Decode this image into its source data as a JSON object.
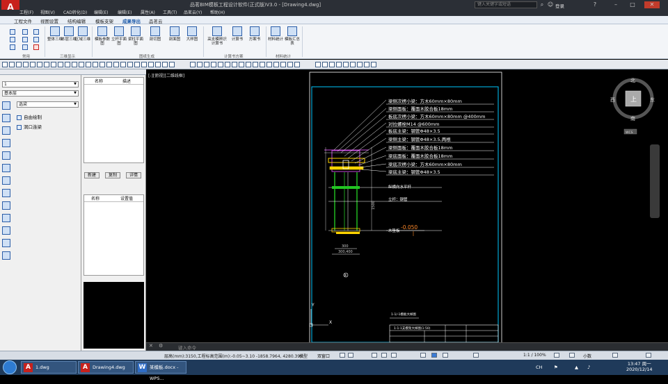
{
  "title_bar": {
    "title": "品茗BIM模板工程设计软件(正式版)V3.0 - [Drawing4.dwg]",
    "search_placeholder": "键入关键字或短语",
    "login": "登录"
  },
  "menu": [
    "工程(F)",
    "视图(V)",
    "CAD转化(D)",
    "编辑(E)",
    "编辑(E)",
    "属性(A)",
    "工具(T)",
    "品茗云(Y)",
    "帮助(H)"
  ],
  "ribbon_tabs": [
    "工程文件",
    "视图设置",
    "结构编辑",
    "模板支架",
    "成果导出",
    "品茗云"
  ],
  "ribbon_active_tab": "成果导出",
  "ribbon_groups": [
    {
      "label": "常用"
    },
    {
      "label": "三维显示",
      "buttons": [
        "整体三维",
        "本层三维",
        "区域三维"
      ]
    },
    {
      "label": "图纸生成",
      "buttons": [
        "模板参数图",
        "立杆平面图",
        "梁柱平面图",
        "剖切图",
        "剖面图",
        "大样图"
      ]
    },
    {
      "label": "计算书方案",
      "buttons": [
        "高支模辨识计算书",
        "计算书",
        "方案书"
      ]
    },
    {
      "label": "材料统计",
      "buttons": [
        "材料统计",
        "模板汇总表"
      ]
    }
  ],
  "left_panel": {
    "floor_select": "1",
    "layer_select": "基本层",
    "mode_select": "选梁",
    "items": [
      "自由绘制",
      "洞口连梁"
    ]
  },
  "props_panel": {
    "top_headers": [
      "名称",
      "描述"
    ],
    "buttons": [
      "新建",
      "复制",
      "详情"
    ],
    "bottom_headers": [
      "名称",
      "设置值"
    ]
  },
  "drawing": {
    "view_label": "[-][俯视][二维线框]",
    "annotations": [
      "梁侧次楞小梁：方木60mm×80mm",
      "梁侧面板：覆面木胶合板18mm",
      "板底次楞小梁：方木60mm×80mm @400mm",
      "对拉螺栓M14 @600mm",
      "板底主梁：钢管Φ48×3.5",
      "梁侧主梁：钢管Φ48×3.5,两根",
      "梁侧面板：覆面木胶合板18mm",
      "梁底面板：覆面木胶合板18mm",
      "梁底次楞小梁：方木60mm×80mm",
      "梁底主梁：钢管Φ48×3.5",
      "纵横向水平杆",
      "立杆：钢管",
      "木垫板"
    ],
    "level_tag": "-0.050",
    "dim_bottom": [
      "300",
      "300,400"
    ],
    "section_tag": "③",
    "title_block_caption": "1-1/-1模板大样图",
    "title_block_name": "1-1-1支模架大样图(1:50)"
  },
  "command_line": {
    "prompt": "键入命令"
  },
  "status_bar": {
    "text": "层高(mm):3150,工程标高范围(m):-0.05~3.10   -1858.7964, 4280.39...",
    "model_tab": "模型",
    "layout_tab": "双窗口",
    "scale": "1:1 / 100%",
    "units": "小数"
  },
  "taskbar": {
    "tasks": [
      "1.dwg",
      "Drawing4.dwg",
      "某模板.docx - WPS..."
    ],
    "clock_time": "13:47 周一",
    "clock_date": "2020/12/14",
    "ime": "CH"
  },
  "viewcube": {
    "north": "北",
    "south": "南",
    "east": "东",
    "west": "西",
    "top": "上",
    "wcs": "WCS"
  },
  "colors": {
    "accent": "#1857a8",
    "cad_cyan": "#00c8ff",
    "cad_green": "#22c622",
    "cad_yellow": "#ffd400",
    "cad_magenta": "#c24ad8",
    "level_orange": "#ff8a2b"
  }
}
